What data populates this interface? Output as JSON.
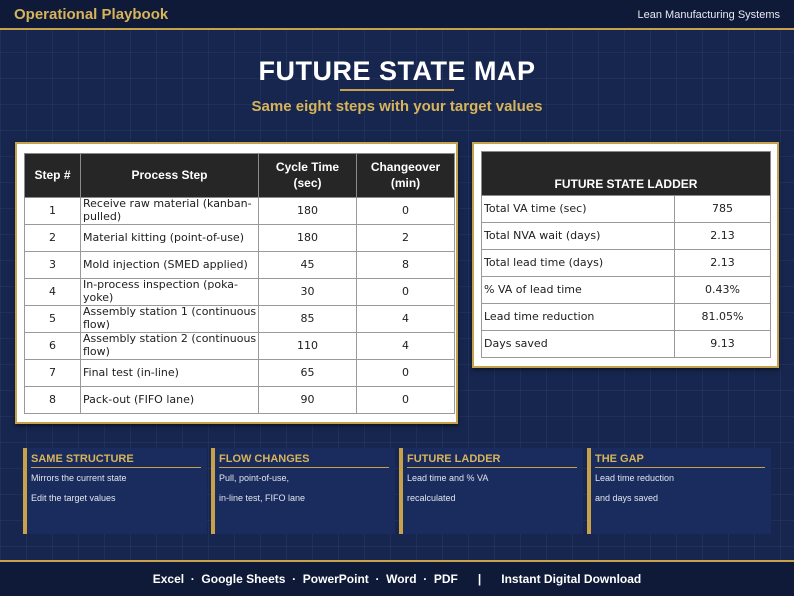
{
  "header": {
    "brand": "Operational Playbook",
    "right_text": "Lean Manufacturing Systems"
  },
  "title": "FUTURE STATE MAP",
  "subtitle": "Same eight steps with your target values",
  "process_table": {
    "headers": [
      "Step #",
      "Process Step",
      "Cycle Time (sec)",
      "Changeover (min)"
    ],
    "rows": [
      {
        "step": "1",
        "name": "Receive raw material (kanban-pulled)",
        "cycle": "180",
        "changeover": "0"
      },
      {
        "step": "2",
        "name": "Material kitting (point-of-use)",
        "cycle": "180",
        "changeover": "2"
      },
      {
        "step": "3",
        "name": "Mold injection (SMED applied)",
        "cycle": "45",
        "changeover": "8"
      },
      {
        "step": "4",
        "name": "In-process inspection (poka-yoke)",
        "cycle": "30",
        "changeover": "0"
      },
      {
        "step": "5",
        "name": "Assembly station 1 (continuous flow)",
        "cycle": "85",
        "changeover": "4"
      },
      {
        "step": "6",
        "name": "Assembly station 2 (continuous flow)",
        "cycle": "110",
        "changeover": "4"
      },
      {
        "step": "7",
        "name": "Final test (in-line)",
        "cycle": "65",
        "changeover": "0"
      },
      {
        "step": "8",
        "name": "Pack-out (FIFO lane)",
        "cycle": "90",
        "changeover": "0"
      }
    ]
  },
  "ladder": {
    "title": "FUTURE STATE LADDER",
    "rows": [
      {
        "label": "Total VA time (sec)",
        "value": "785"
      },
      {
        "label": "Total NVA wait (days)",
        "value": "2.13"
      },
      {
        "label": "Total lead time (days)",
        "value": "2.13"
      },
      {
        "label": "% VA of lead time",
        "value": "0.43%"
      },
      {
        "label": "Lead time reduction",
        "value": "81.05%"
      },
      {
        "label": "Days saved",
        "value": "9.13"
      }
    ]
  },
  "cards": [
    {
      "title": "SAME STRUCTURE",
      "line1": "Mirrors the current state",
      "line2": "Edit the target values"
    },
    {
      "title": "FLOW CHANGES",
      "line1": "Pull, point-of-use,",
      "line2": "in-line test, FIFO lane"
    },
    {
      "title": "FUTURE LADDER",
      "line1": "Lead time and % VA",
      "line2": "recalculated"
    },
    {
      "title": "THE GAP",
      "line1": "Lead time reduction",
      "line2": "and days saved"
    }
  ],
  "footer": "Excel  ·  Google Sheets  ·  PowerPoint  ·  Word  ·  PDF      |      Instant Digital Download",
  "colors": {
    "background": "#16264f",
    "accent_gold": "#c8a24a",
    "header_dark": "#262626"
  }
}
